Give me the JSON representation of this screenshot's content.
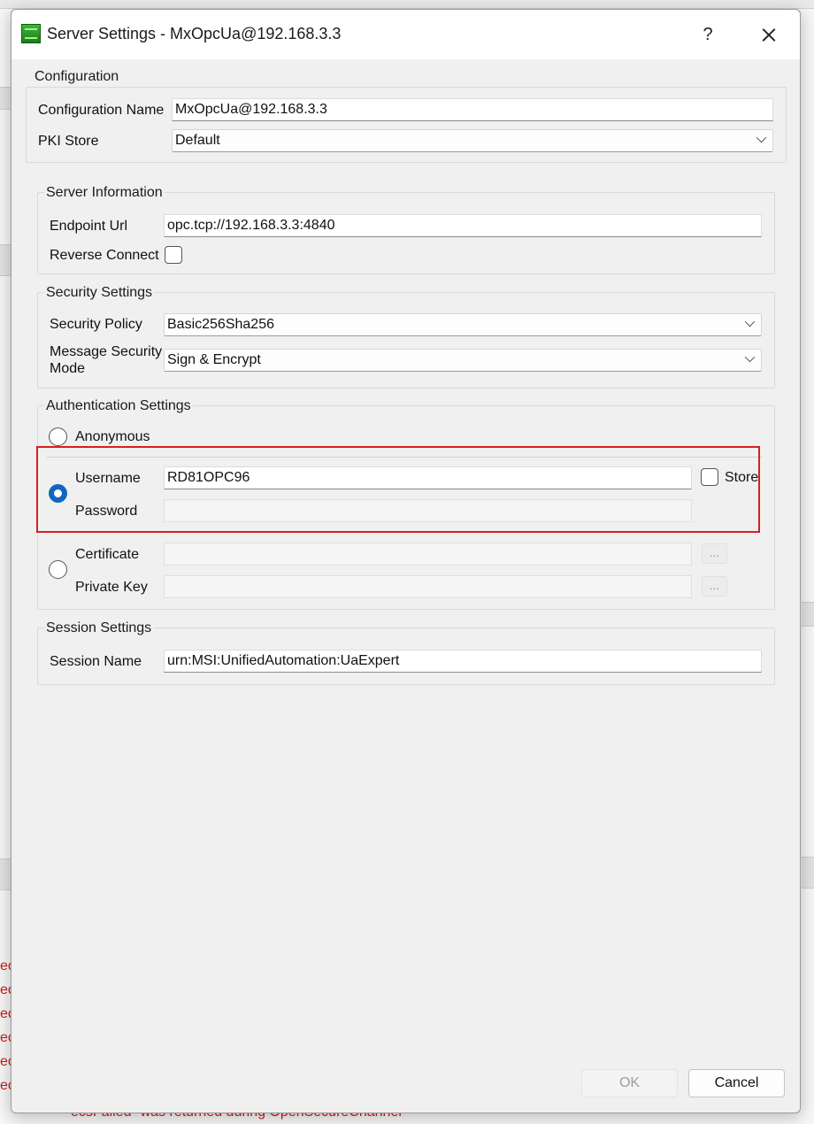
{
  "dialog": {
    "title": "Server Settings - MxOpcUa@192.168.3.3",
    "help_label": "?"
  },
  "configuration": {
    "group_title": "Configuration",
    "name_label": "Configuration Name",
    "name_value": "MxOpcUa@192.168.3.3",
    "pki_label": "PKI Store",
    "pki_value": "Default"
  },
  "server_info": {
    "group_title": "Server Information",
    "endpoint_label": "Endpoint Url",
    "endpoint_value": "opc.tcp://192.168.3.3:4840",
    "reverse_label": "Reverse Connect",
    "reverse_checked": false
  },
  "security": {
    "group_title": "Security Settings",
    "policy_label": "Security Policy",
    "policy_value": "Basic256Sha256",
    "mode_label": "Message Security Mode",
    "mode_value": "Sign & Encrypt"
  },
  "authentication": {
    "group_title": "Authentication Settings",
    "anonymous_label": "Anonymous",
    "selected_method": "username",
    "username_label": "Username",
    "username_value": "RD81OPC96",
    "store_label": "Store",
    "store_checked": false,
    "password_label": "Password",
    "password_value": "",
    "certificate_label": "Certificate",
    "certificate_value": "",
    "private_key_label": "Private Key",
    "private_key_value": "",
    "browse_label": "..."
  },
  "session": {
    "group_title": "Session Settings",
    "name_label": "Session Name",
    "name_value": "urn:MSI:UnifiedAutomation:UaExpert"
  },
  "buttons": {
    "ok": "OK",
    "cancel": "Cancel"
  },
  "background": {
    "log_fragments": [
      "ec",
      "ec",
      "ec",
      "ec",
      "ec",
      "ec"
    ],
    "footer_text": "ecsFailed\" was returned during OpenSecureChannel"
  },
  "colors": {
    "accent": "#0f67c0",
    "highlight": "#d42020",
    "error_text": "#d01818"
  }
}
